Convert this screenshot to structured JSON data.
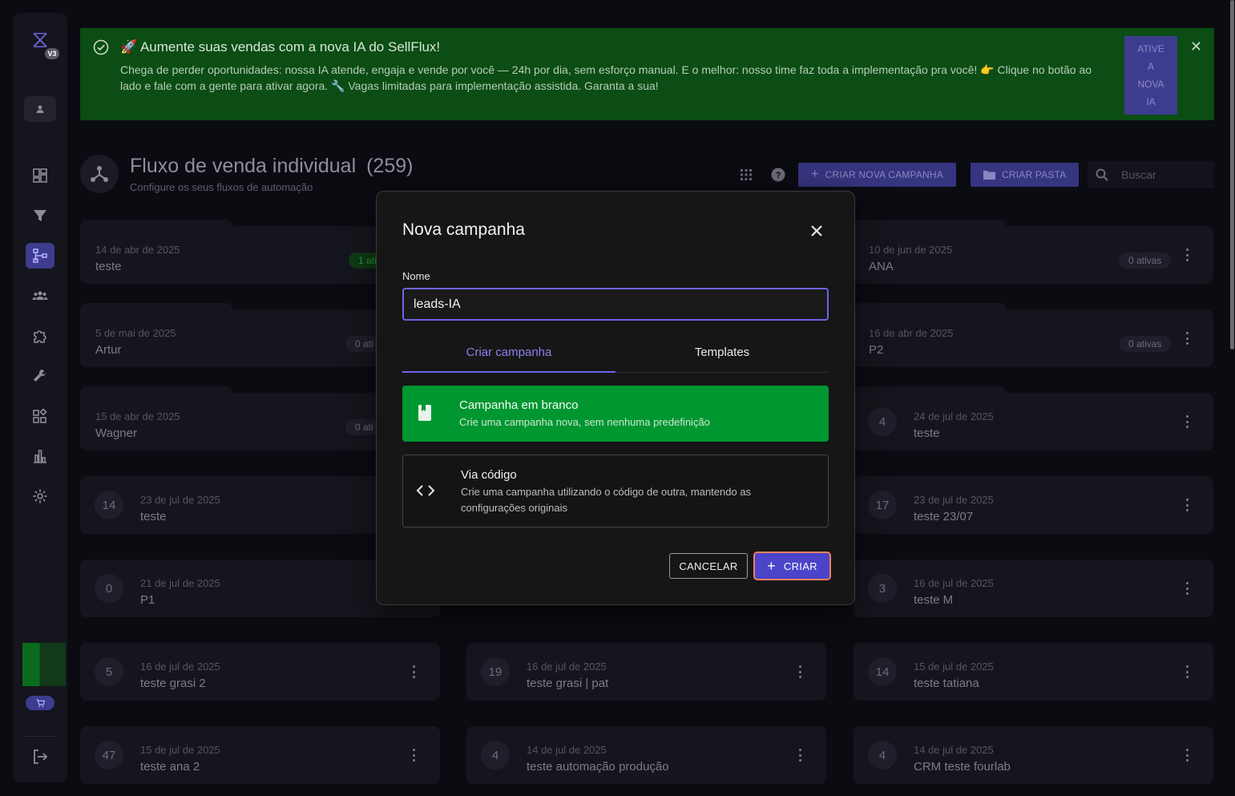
{
  "sidebar": {
    "version_badge": "V3",
    "items": [
      {
        "icon": "dashboard-icon",
        "active": false
      },
      {
        "icon": "filter-icon",
        "active": false
      },
      {
        "icon": "flow-icon",
        "active": true
      },
      {
        "icon": "users-icon",
        "active": false
      },
      {
        "icon": "puzzle-icon",
        "active": false
      },
      {
        "icon": "wrench-icon",
        "active": false
      },
      {
        "icon": "widgets-icon",
        "active": false
      },
      {
        "icon": "chart-icon",
        "active": false
      },
      {
        "icon": "gear-icon",
        "active": false
      }
    ]
  },
  "banner": {
    "title": "🚀 Aumente suas vendas com a nova IA do SellFlux!",
    "text": "Chega de perder oportunidades: nossa IA atende, engaja e vende por você — 24h por dia, sem esforço manual. E o melhor: nosso time faz toda a implementação pra você! 👉 Clique no botão ao lado e fale com a gente para ativar agora. 🔧 Vagas limitadas para implementação assistida. Garanta a sua!",
    "cta_lines": [
      "ATIVE",
      "A",
      "NOVA",
      "IA"
    ]
  },
  "header": {
    "title": "Fluxo de venda individual",
    "count": "(259)",
    "subtitle": "Configure os seus fluxos de automação",
    "create_campaign_label": "CRIAR NOVA CAMPANHA",
    "create_folder_label": "CRIAR PASTA",
    "search_placeholder": "Buscar"
  },
  "cards": [
    {
      "date": "14 de abr de 2025",
      "name": "teste",
      "pill": "1 ativ"
    },
    {
      "date": "10 de jun de 2025",
      "name": "ANA",
      "pill": "0 ativas"
    },
    {
      "date": "5 de mai de 2025",
      "name": "Artur",
      "pill": "0 ati"
    },
    {
      "date": "16 de abr de 2025",
      "name": "P2",
      "pill": "0 ativas"
    },
    {
      "date": "15 de abr de 2025",
      "name": "Wagner",
      "pill": "0 ati"
    },
    {
      "count": "4",
      "date": "24 de jul de 2025",
      "name": "teste"
    },
    {
      "count": "14",
      "date": "23 de jul de 2025",
      "name": "teste"
    },
    {
      "count": "17",
      "date": "23 de jul de 2025",
      "name": "teste 23/07"
    },
    {
      "count": "0",
      "date": "21 de jul de 2025",
      "name": "P1"
    },
    {
      "count": "3",
      "date": "16 de jul de 2025",
      "name": "teste M"
    },
    {
      "count": "5",
      "date": "16 de jul de 2025",
      "name": "teste grasi 2"
    },
    {
      "count": "19",
      "date": "16 de jul de 2025",
      "name": "teste grasi | pat"
    },
    {
      "count": "14",
      "date": "15 de jul de 2025",
      "name": "teste tatiana"
    },
    {
      "count": "47",
      "date": "15 de jul de 2025",
      "name": "teste ana 2"
    },
    {
      "count": "4",
      "date": "14 de jul de 2025",
      "name": "teste automação produção"
    },
    {
      "count": "4",
      "date": "14 de jul de 2025",
      "name": "CRM teste fourlab"
    }
  ],
  "modal": {
    "title": "Nova campanha",
    "name_label": "Nome",
    "name_value": "leads-IA",
    "tab_create": "Criar campanha",
    "tab_templates": "Templates",
    "blank_title": "Campanha em branco",
    "blank_desc": "Crie uma campanha nova, sem nenhuma predefinição",
    "code_title": "Via código",
    "code_desc": "Crie uma campanha utilizando o código de outra, mantendo as configurações originais",
    "cancel_label": "CANCELAR",
    "create_label": "CRIAR"
  }
}
